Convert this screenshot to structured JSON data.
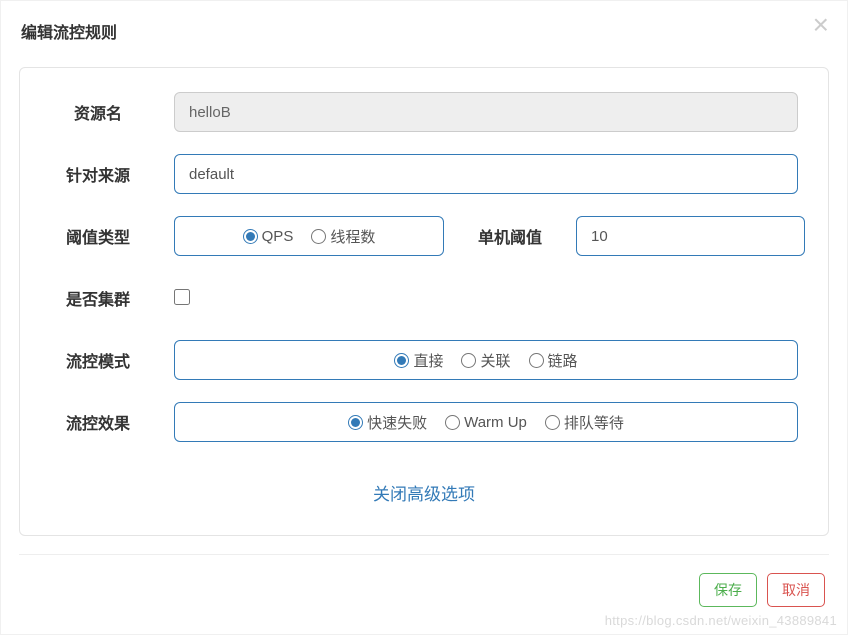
{
  "modal": {
    "title": "编辑流控规则"
  },
  "form": {
    "resource": {
      "label": "资源名",
      "value": "helloB"
    },
    "limitApp": {
      "label": "针对来源",
      "value": "default"
    },
    "thresholdType": {
      "label": "阈值类型",
      "options": {
        "qps": "QPS",
        "threadCount": "线程数"
      },
      "selected": "qps"
    },
    "threshold": {
      "label": "单机阈值",
      "value": "10"
    },
    "cluster": {
      "label": "是否集群",
      "checked": false
    },
    "mode": {
      "label": "流控模式",
      "options": {
        "direct": "直接",
        "relate": "关联",
        "chain": "链路"
      },
      "selected": "direct"
    },
    "effect": {
      "label": "流控效果",
      "options": {
        "fastFail": "快速失败",
        "warmUp": "Warm Up",
        "queue": "排队等待"
      },
      "selected": "fastFail"
    }
  },
  "advancedToggle": "关闭高级选项",
  "footer": {
    "save": "保存",
    "cancel": "取消"
  },
  "watermark": "https://blog.csdn.net/weixin_43889841"
}
